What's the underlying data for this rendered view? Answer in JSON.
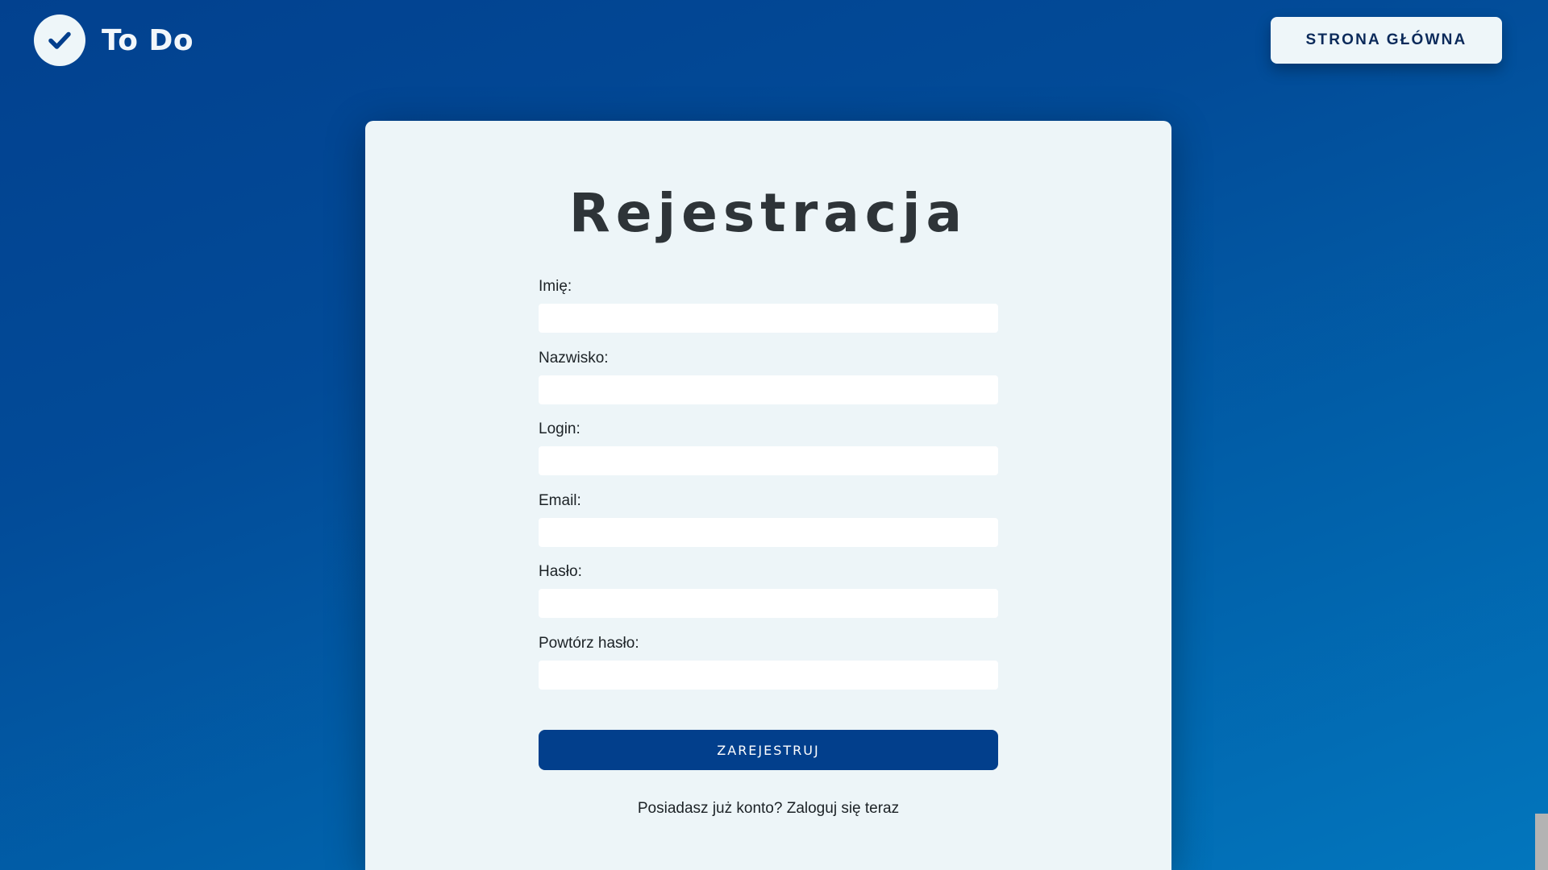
{
  "header": {
    "app_name": "To Do",
    "home_button_label": "STRONA GŁÓWNA"
  },
  "form": {
    "title": "Rejestracja",
    "fields": [
      {
        "label": "Imię:",
        "value": ""
      },
      {
        "label": "Nazwisko:",
        "value": ""
      },
      {
        "label": "Login:",
        "value": ""
      },
      {
        "label": "Email:",
        "value": ""
      },
      {
        "label": "Hasło:",
        "value": ""
      },
      {
        "label": "Powtórz hasło:",
        "value": ""
      }
    ],
    "submit_label": "ZAREJESTRUJ",
    "login_prompt": "Posiadasz już konto?",
    "login_link": "Zaloguj się teraz"
  },
  "colors": {
    "background_top": "#02418f",
    "background_bottom": "#0276bd",
    "card_bg": "#edf5f8",
    "submit_bg": "#023f8c",
    "title_text": "#2e3438"
  },
  "icons": {
    "logo": "check-icon"
  }
}
